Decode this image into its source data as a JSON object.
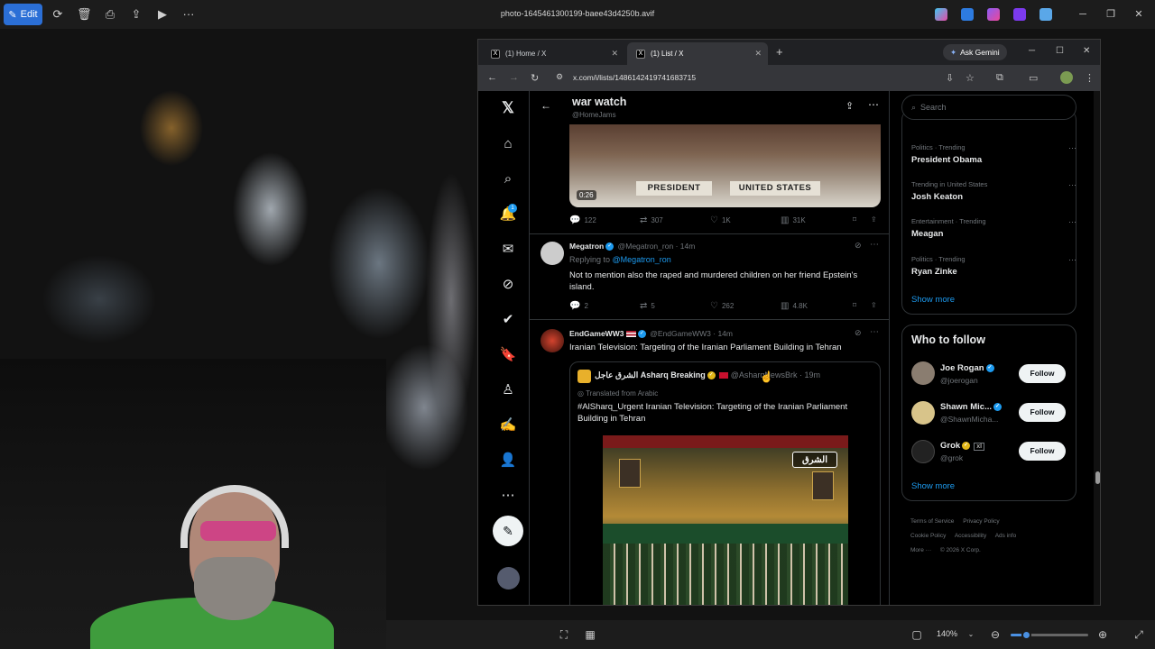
{
  "viewer": {
    "edit_label": "Edit",
    "file_title": "photo-1645461300199-baee43d4250b.avif",
    "zoom_label": "140%",
    "zoom_fraction": 0.2,
    "icons": [
      "rotate-icon",
      "delete-icon",
      "print-icon",
      "share-icon",
      "slideshow-icon",
      "more-icon"
    ]
  },
  "browser": {
    "tabs": [
      {
        "label": "(1) Home / X",
        "favicon": "X"
      },
      {
        "label": "(1) List / X",
        "favicon": "X"
      }
    ],
    "new_tab": "+",
    "gemini_label": "Ask Gemini",
    "url": "x.com/i/lists/1486142419741683715"
  },
  "x": {
    "notif_count": "1",
    "list": {
      "title": "war watch",
      "handle": "@HomeJams"
    },
    "video": {
      "duration": "0:26",
      "placard_left": "PRESIDENT",
      "placard_right": "UNITED STATES"
    },
    "first_actions": {
      "replies": "122",
      "reposts": "307",
      "likes": "1K",
      "views": "31K"
    },
    "posts": [
      {
        "name": "Megatron",
        "handle": "@Megatron_ron",
        "time": "· 14m",
        "replying_prefix": "Replying to",
        "replying_to": "@Megatron_ron",
        "text": "Not to mention also the raped and murdered children on her friend Epstein's island.",
        "replies": "2",
        "reposts": "5",
        "likes": "262",
        "views": "4.8K"
      },
      {
        "name": "EndGameWW3",
        "handle": "@EndGameWW3",
        "time": "· 14m",
        "text": "Iranian Television: Targeting of the Iranian Parliament Building in Tehran"
      }
    ],
    "quote": {
      "name": "الشرق عاجل Asharq Breaking",
      "handle": "@AsharqNewsBrk",
      "time": "· 19m",
      "translated": "Translated from Arabic",
      "text": "#AlSharq_Urgent Iranian Television: Targeting of the Iranian Parliament Building in Tehran",
      "image_brand": "الشرق"
    },
    "search_placeholder": "Search",
    "trends": [
      {
        "category": "Politics · Trending",
        "name": "President Obama"
      },
      {
        "category": "Trending in United States",
        "name": "Josh Keaton"
      },
      {
        "category": "Entertainment · Trending",
        "name": "Meagan"
      },
      {
        "category": "Politics · Trending",
        "name": "Ryan Zinke"
      }
    ],
    "show_more": "Show more",
    "who_to_follow": {
      "title": "Who to follow",
      "accounts": [
        {
          "name": "Joe Rogan",
          "handle": "@joerogan"
        },
        {
          "name": "Shawn Mic...",
          "handle": "@ShawnMicha..."
        },
        {
          "name": "Grok",
          "handle": "@grok"
        }
      ],
      "follow_label": "Follow",
      "show_more": "Show more"
    },
    "footer": [
      "Terms of Service",
      "Privacy Policy",
      "Cookie Policy",
      "Accessibility",
      "Ads info",
      "More ···",
      "© 2026 X Corp."
    ]
  }
}
